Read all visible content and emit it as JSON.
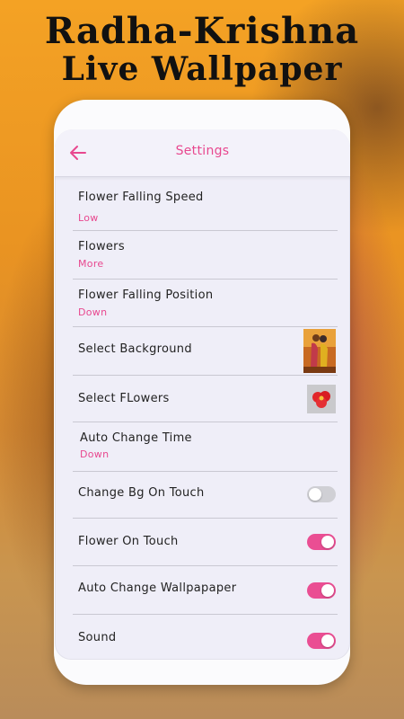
{
  "promo": {
    "line1": "Radha-Krishna",
    "line2": "Live Wallpaper"
  },
  "appbar": {
    "title": "Settings",
    "back_icon": "arrow-left-icon"
  },
  "settings": [
    {
      "label": "Flower Falling Speed",
      "value": "Low"
    },
    {
      "label": "Flowers",
      "value": "More"
    },
    {
      "label": "Flower Falling Position",
      "value": "Down"
    },
    {
      "label": "Select Background",
      "thumbnail": "radha-krishna-thumbnail"
    },
    {
      "label": "Select FLowers",
      "thumbnail": "red-flower-thumbnail"
    },
    {
      "label": "Auto Change Time",
      "value": "Down"
    },
    {
      "label": "Change Bg On Touch",
      "toggle": false
    },
    {
      "label": "Flower On Touch",
      "toggle": true
    },
    {
      "label": "Auto Change Wallpapaper",
      "toggle": true
    },
    {
      "label": "Sound",
      "toggle": true
    }
  ],
  "colors": {
    "accent": "#e8488f",
    "toggle_on": "#ea4e93",
    "toggle_off": "#d0d0d5"
  }
}
